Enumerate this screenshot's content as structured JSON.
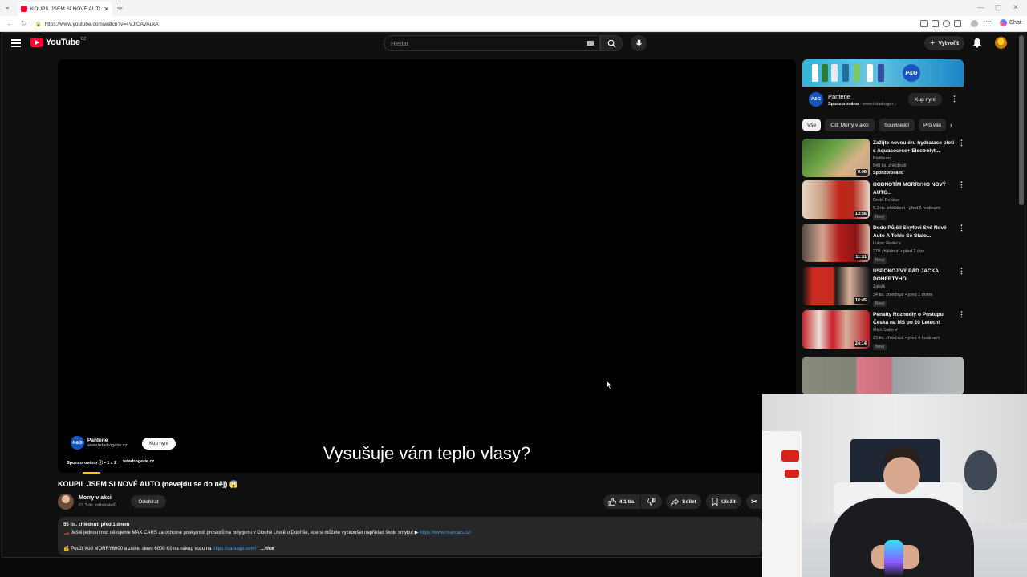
{
  "browser": {
    "tab_title": "KOUPIL JSEM SI NOVÉ AUTO (nevejdu se do něj)",
    "tab_title_display": "KOUPIL JSEM SI NOVÉ AUTO (neve",
    "url": "https://www.youtube.com/watch?v=4VJlCAVAukA",
    "chat_label": "Chat"
  },
  "header": {
    "logo_text": "YouTube",
    "country_code": "CZ",
    "search_placeholder": "Hledat",
    "create_label": "Vytvořit"
  },
  "player": {
    "subtitle": "Vysušuje vám teplo vlasy?",
    "ad": {
      "advertiser": "Pantene",
      "domain": "tetadrogerie.cz",
      "domain_display": "www.tetadrogerie.cz",
      "buy_label": "Kup nyní",
      "sponsored": "Sponzorováno",
      "ad_count": "1 z 2",
      "logo_text": "P&G"
    }
  },
  "video": {
    "title": "KOUPIL JSEM SI NOVÉ AUTO (nevejdu se do něj) 😱",
    "channel_name": "Morry v akci",
    "subscribers": "63,3 tis. odběratelů",
    "subscribe_label": "Odebírat",
    "likes": "4,1 tis.",
    "share_label": "Sdílet",
    "save_label": "Uložit"
  },
  "description": {
    "meta": "55 tis. zhlédnutí  před 1 dnem",
    "line1": "🏎️ Ještě jednou moc děkujeme MAX CARS za ochotné poskytnutí prostorů na polygonu v Dlouhé Lhotě u Dobříše, kde si můžete vyzkoušet například školu smyku! ▶ ",
    "link1": "https://www.maxcars.cz/",
    "line2": "💰 Použij kód MORRY6000 a získej slevu 6000 Kč na nákup vozu na ",
    "link2": "https://carvago.com/",
    "more": "...více"
  },
  "sidebar_ad": {
    "name": "Pantene",
    "sponsored": "Sponzorováno",
    "domain": "www.tetadroger...",
    "buy_label": "Kup nyní",
    "logo_text": "P&G"
  },
  "chips": [
    "Vše",
    "Od: Morry v akci",
    "Souvisejicí",
    "Pro vás"
  ],
  "recommendations": [
    {
      "title": "Zažijte novou éru hydratace pleti s Aquasource+ Electrolyt...",
      "channel": "Biotherm",
      "stats": "648 tis. zhlédnutí",
      "extra": "Sponzorováno",
      "duration": "0:06",
      "colors": [
        "#3a6a2a",
        "#d9b28a"
      ]
    },
    {
      "title": "HODNOTÍM MORRYHO NOVÝ AUTO..",
      "channel": "Dodo Reakce",
      "stats": "5,2 tis. zhlédnutí • před 5 hodinami",
      "badge": "Nový",
      "duration": "13:56",
      "colors": [
        "#c2241b",
        "#e7d3c0"
      ]
    },
    {
      "title": "Dodo Půjčil Skyfovi Své Nové Auto A Tohle Se Stalo...",
      "channel": "Lukec Reakce",
      "stats": "270 zhlédnutí • před 2 dny",
      "badge": "Nový",
      "duration": "11:31",
      "colors": [
        "#b01c1c",
        "#5a4b46"
      ]
    },
    {
      "title": "USPOKOJIVÝ PÁD JACKA DOHERTYHO",
      "channel": "Žabák",
      "stats": "34 tis. zhlédnutí • před 1 dnem",
      "badge": "Nový",
      "duration": "16:45",
      "colors": [
        "#111111",
        "#c92b20"
      ]
    },
    {
      "title": "Penalty Rozhodly o Postupu Česka na MS po 20 Letech!",
      "channel": "Mich Sako",
      "stats": "23 tis. zhlédnutí • před 4 hodinami",
      "badge": "Nový",
      "duration": "24:14",
      "colors": [
        "#c8202a",
        "#e8e0d8"
      ]
    }
  ],
  "icons": {
    "brand_red": "#ff0033",
    "link_blue": "#3ea6ff",
    "progress_yellow": "#ffcc00"
  }
}
